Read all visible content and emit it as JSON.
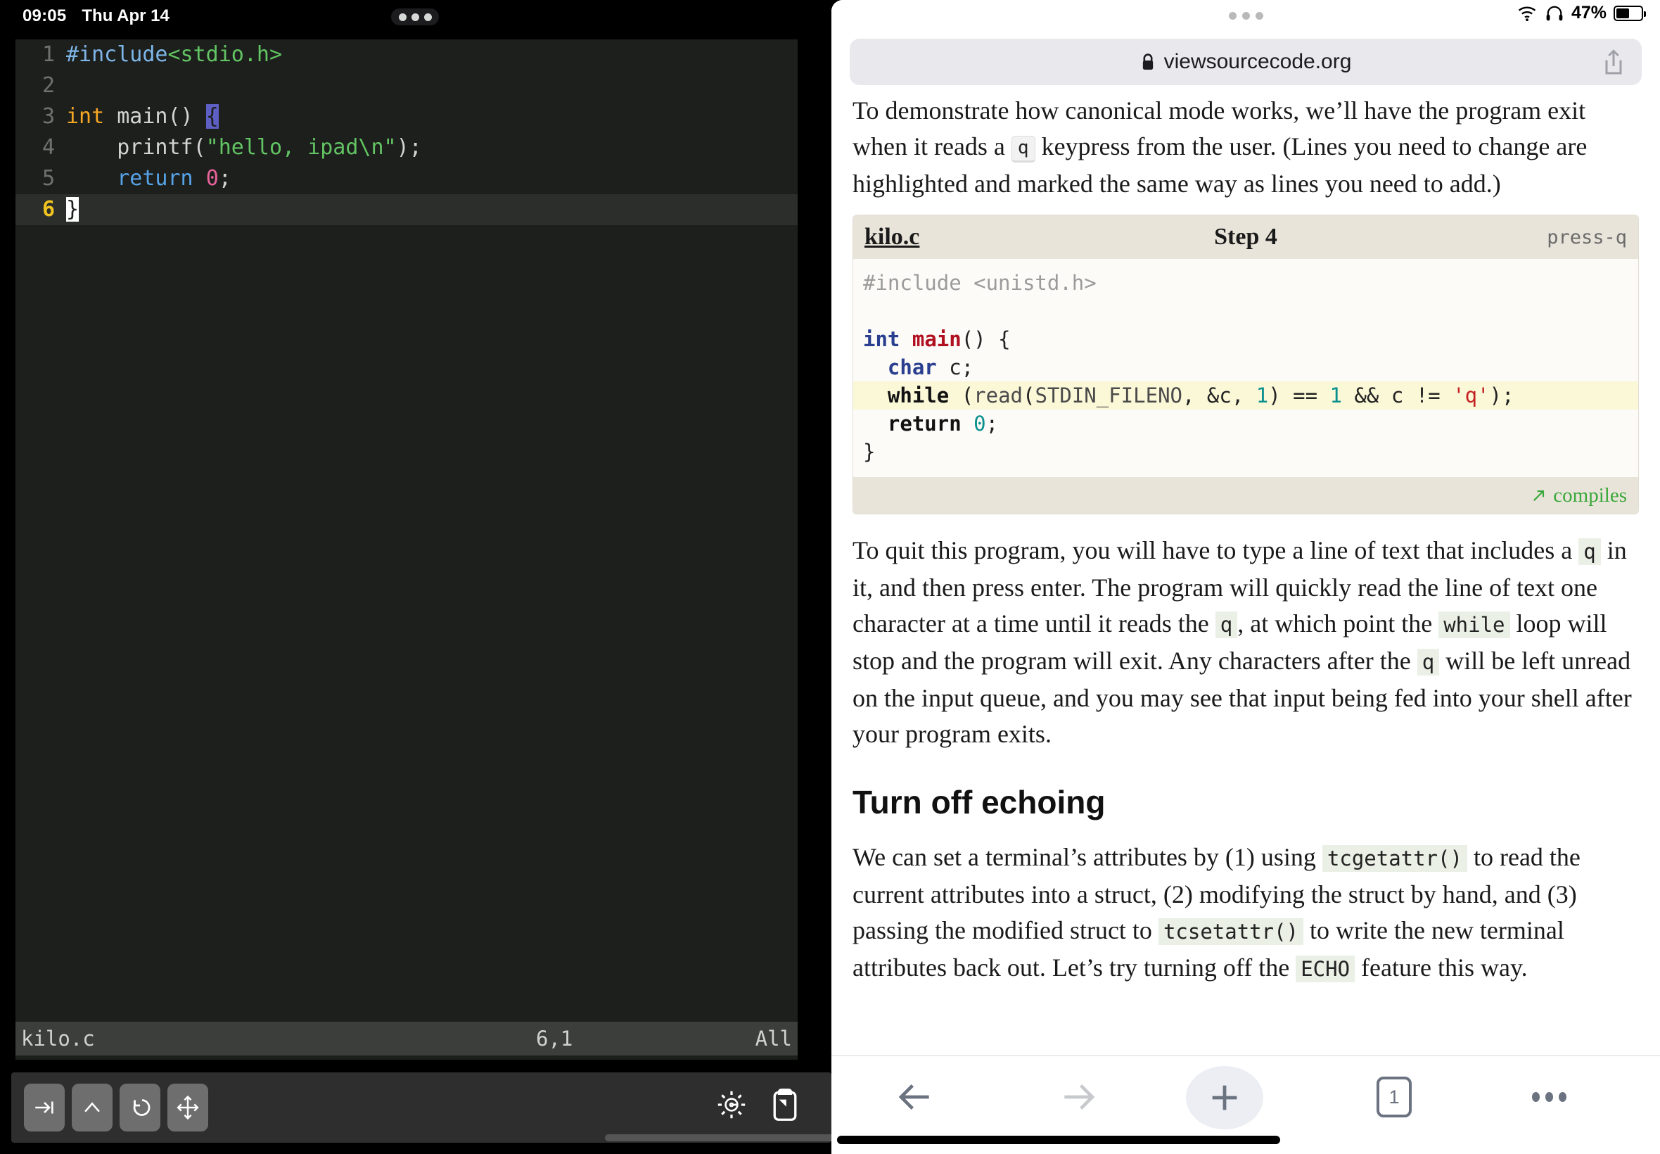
{
  "left": {
    "status_bar": {
      "time": "09:05",
      "date": "Thu Apr 14"
    },
    "editor": {
      "lines": [
        {
          "num": "1",
          "text": "#include<stdio.h>"
        },
        {
          "num": "2",
          "text": ""
        },
        {
          "num": "3",
          "text": "int main() {"
        },
        {
          "num": "4",
          "text": "    printf(\"hello, ipad\\n\");"
        },
        {
          "num": "5",
          "text": "    return 0;"
        },
        {
          "num": "6",
          "text": "}"
        }
      ]
    },
    "vim_status": {
      "filename": "kilo.c",
      "position": "6,1",
      "scroll": "All"
    },
    "toolbar": {
      "tab_key": "tab-key",
      "ctrl_key": "ctrl-key",
      "esc_key": "esc-key",
      "arrows_key": "arrow-keys",
      "settings": "gear-icon",
      "paste": "paste-icon"
    }
  },
  "right": {
    "status_bar": {
      "battery_percent": "47%"
    },
    "url_bar": {
      "url": "viewsourcecode.org",
      "lock": "lock-icon"
    },
    "article": {
      "p1_part1": "To demonstrate how canonical mode works, we’ll have the program exit when it reads a ",
      "p1_kbd": "q",
      "p1_part2": " keypress from the user. (Lines you need to change are highlighted and marked the same way as lines you need to add.)",
      "code_block": {
        "filename": "kilo.c",
        "step": "Step 4",
        "tag": "press-q",
        "lines": [
          {
            "text": "#include <unistd.h>",
            "highlight": false
          },
          {
            "text": "",
            "highlight": false
          },
          {
            "text": "int main() {",
            "highlight": false
          },
          {
            "text": "  char c;",
            "highlight": false
          },
          {
            "text": "  while (read(STDIN_FILENO, &c, 1) == 1 && c != 'q');",
            "highlight": true
          },
          {
            "text": "  return 0;",
            "highlight": false
          },
          {
            "text": "}",
            "highlight": false
          }
        ],
        "footer": "compiles",
        "footer_icon": "arrow-up-right-icon"
      },
      "p2_a": "To quit this program, you will have to type a line of text that includes a ",
      "p2_c1": "q",
      "p2_b": " in it, and then press enter. The program will quickly read the line of text one character at a time until it reads the ",
      "p2_c2": "q",
      "p2_c": ", at which point the ",
      "p2_c3": "while",
      "p2_d": " loop will stop and the program will exit. Any characters after the ",
      "p2_c4": "q",
      "p2_e": " will be left unread on the input queue, and you may see that input being fed into your shell after your program exits.",
      "heading": "Turn off echoing",
      "p3_a": "We can set a terminal’s attributes by (1) using ",
      "p3_c1": "tcgetattr()",
      "p3_b": " to read the current attributes into a struct, (2) modifying the struct by hand, and (3) passing the modified struct to ",
      "p3_c2": "tcsetattr()",
      "p3_c": " to write the new terminal attributes back out. Let’s try turning off the ",
      "p3_c3": "ECHO",
      "p3_d": " feature this way."
    },
    "toolbar": {
      "back": "back-icon",
      "forward": "forward-icon",
      "new_tab": "plus-icon",
      "tab_count": "1",
      "more": "more-icon"
    }
  },
  "colors": {
    "terminal_bg": "#1d1f1d",
    "vim_status_bg": "#3b3e3b",
    "code_highlight": "#fbf8d8",
    "code_block_header": "#e9e4da",
    "compiles_green": "#3aa83a",
    "inline_code_bg": "#eaf0e6"
  }
}
